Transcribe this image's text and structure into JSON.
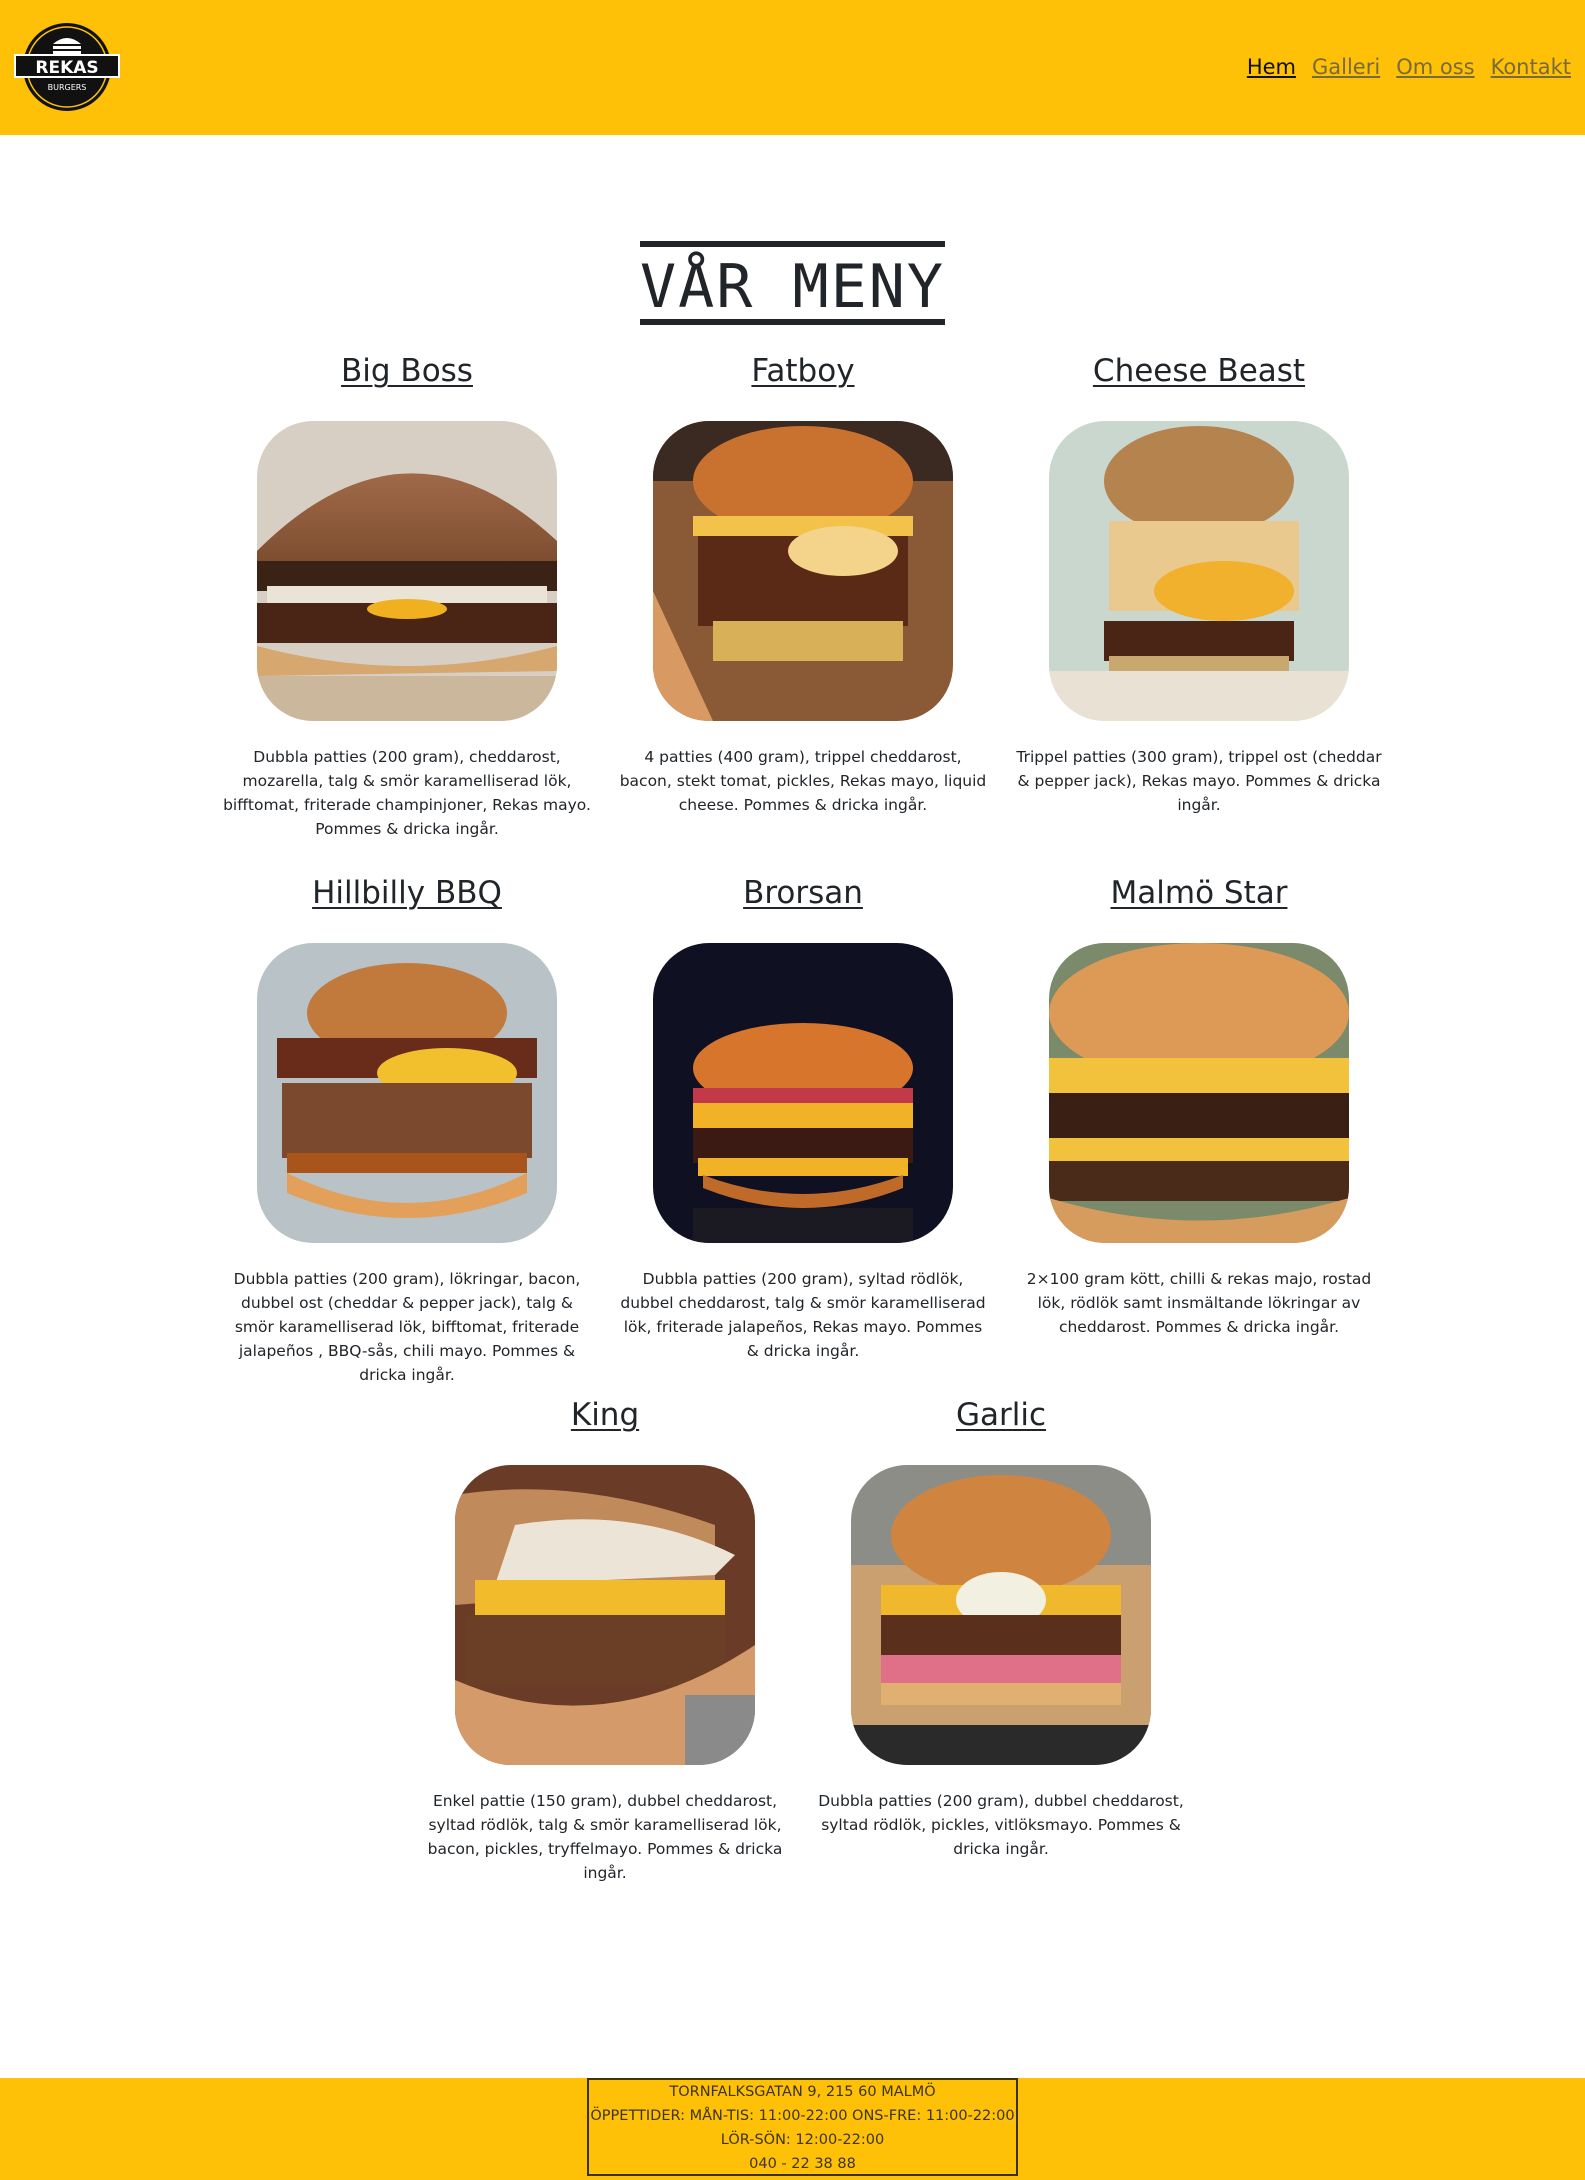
{
  "brand": {
    "logo_text": "REKAS",
    "logo_subtext": "BURGERS"
  },
  "nav": [
    {
      "label": "Hem"
    },
    {
      "label": "Galleri"
    },
    {
      "label": "Om oss"
    },
    {
      "label": "Kontakt"
    }
  ],
  "page_title": "VÅR MENY",
  "menu": [
    {
      "name": "Big Boss",
      "description": "Dubbla patties (200 gram), cheddarost, mozarella, talg & smör karamelliserad lök, bifftomat, friterade champinjoner, Rekas mayo. Pommes & dricka ingår."
    },
    {
      "name": "Fatboy",
      "description": "4 patties (400 gram), trippel cheddarost, bacon, stekt tomat, pickles, Rekas mayo, liquid cheese. Pommes & dricka ingår."
    },
    {
      "name": "Cheese Beast",
      "description": "Trippel patties (300 gram), trippel ost (cheddar & pepper jack), Rekas mayo. Pommes & dricka ingår."
    },
    {
      "name": "Hillbilly BBQ",
      "description": "Dubbla patties (200 gram), lökringar, bacon, dubbel ost (cheddar & pepper jack), talg & smör karamelliserad lök, bifftomat, friterade jalapeños , BBQ-sås, chili mayo. Pommes & dricka ingår."
    },
    {
      "name": "Brorsan",
      "description": "Dubbla patties (200 gram), syltad rödlök, dubbel cheddarost, talg & smör karamelliserad lök, friterade jalapeños, Rekas mayo. Pommes & dricka ingår."
    },
    {
      "name": "Malmö Star",
      "description": "2×100 gram kött, chilli & rekas majo, rostad lök, rödlök samt insmältande lökringar av cheddarost. Pommes & dricka ingår."
    },
    {
      "name": "King",
      "description": "Enkel pattie (150 gram), dubbel cheddarost, syltad rödlök, talg & smör karamelliserad lök, bacon, pickles, tryffelmayo. Pommes & dricka ingår."
    },
    {
      "name": "Garlic",
      "description": "Dubbla patties (200 gram), dubbel cheddarost, syltad rödlök, pickles, vitlöksmayo. Pommes & dricka ingår."
    }
  ],
  "footer": {
    "address": "TORNFALKSGATAN 9, 215 60 MALMÖ",
    "hours_weekday": "ÖPPETTIDER: MÅN-TIS: 11:00-22:00 ONS-FRE: 11:00-22:00",
    "hours_weekend": "LÖR-SÖN: 12:00-22:00",
    "phone": "040 - 22 38 88"
  },
  "colors": {
    "header_bg": "#ffc107",
    "footer_bg": "#ffc107",
    "text": "#212529"
  }
}
